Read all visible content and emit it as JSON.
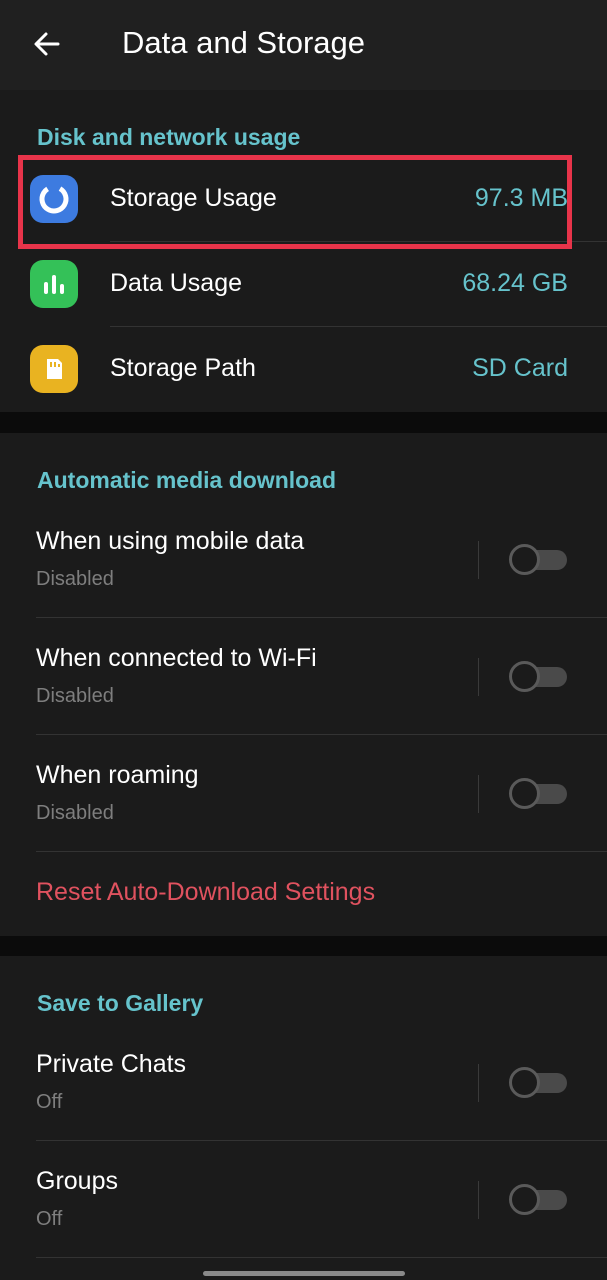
{
  "header": {
    "title": "Data and Storage"
  },
  "disk_section": {
    "title": "Disk and network usage",
    "items": [
      {
        "label": "Storage Usage",
        "value": "97.3 MB",
        "icon": "storage-usage-icon",
        "color": "#3d7be0"
      },
      {
        "label": "Data Usage",
        "value": "68.24 GB",
        "icon": "data-usage-icon",
        "color": "#34c158"
      },
      {
        "label": "Storage Path",
        "value": "SD Card",
        "icon": "sd-card-icon",
        "color": "#e9b321"
      }
    ]
  },
  "auto_download": {
    "title": "Automatic media download",
    "items": [
      {
        "label": "When using mobile data",
        "sub": "Disabled",
        "enabled": false
      },
      {
        "label": "When connected to Wi-Fi",
        "sub": "Disabled",
        "enabled": false
      },
      {
        "label": "When roaming",
        "sub": "Disabled",
        "enabled": false
      }
    ],
    "reset_label": "Reset Auto-Download Settings"
  },
  "gallery": {
    "title": "Save to Gallery",
    "items": [
      {
        "label": "Private Chats",
        "sub": "Off",
        "enabled": false
      },
      {
        "label": "Groups",
        "sub": "Off",
        "enabled": false
      }
    ]
  },
  "colors": {
    "accent": "#66c3cc",
    "danger": "#e0525f",
    "highlight": "#e8344a"
  }
}
